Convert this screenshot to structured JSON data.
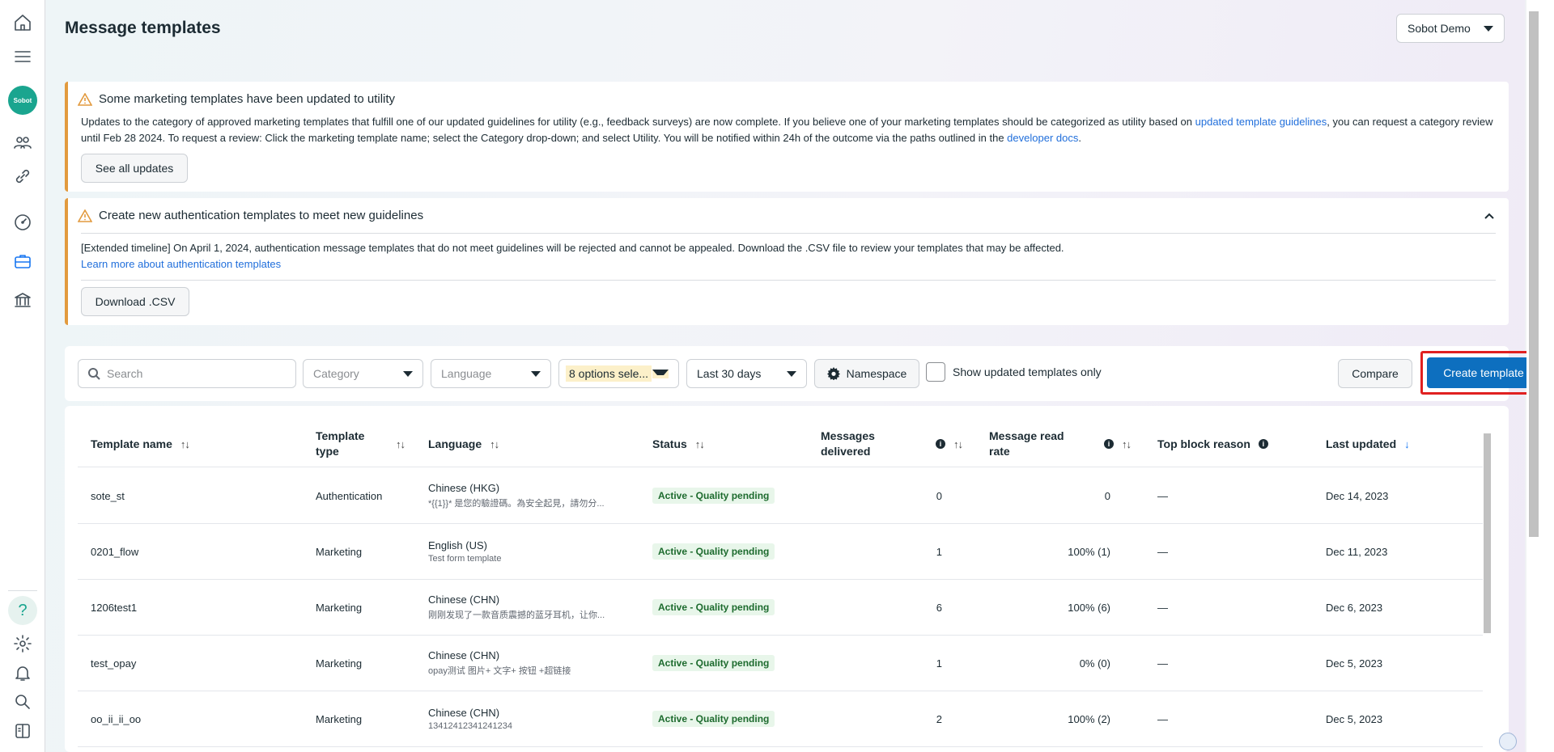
{
  "page": {
    "title": "Message templates",
    "account": "Sobot Demo"
  },
  "sidebar": {
    "logo_text": "Sobot",
    "help": "?"
  },
  "banners": [
    {
      "title": "Some marketing templates have been updated to utility",
      "body_pre": "Updates to the category of approved marketing templates that fulfill one of our updated guidelines for utility (e.g., feedback surveys) are now complete. If you believe one of your marketing templates should be categorized as utility based on ",
      "body_link1": "updated template guidelines",
      "body_mid": ", you can request a category review until Feb 28 2024. To request a review: Click the marketing template name; select the Category drop-down; and select Utility. You will be notified within 24h of the outcome via the paths outlined in the ",
      "body_link2": "developer docs",
      "body_end": ".",
      "button": "See all updates"
    },
    {
      "title": "Create new authentication templates to meet new guidelines",
      "body": "[Extended timeline] On April 1, 2024, authentication message templates that do not meet guidelines will be rejected and cannot be appealed. Download the .CSV file to review your templates that may be affected.",
      "link": "Learn more about authentication templates",
      "button": "Download .CSV"
    }
  ],
  "filters": {
    "search_placeholder": "Search",
    "category": "Category",
    "language": "Language",
    "status": "8 options sele...",
    "date_range": "Last 30 days",
    "namespace": "Namespace",
    "show_updated": "Show updated templates only",
    "compare": "Compare",
    "create": "Create template"
  },
  "table": {
    "columns": {
      "name": "Template name",
      "type": "Template type",
      "language": "Language",
      "status": "Status",
      "delivered": "Messages delivered",
      "read_rate": "Message read rate",
      "block": "Top block reason",
      "updated": "Last updated"
    },
    "rows": [
      {
        "name": "sote_st",
        "type": "Authentication",
        "language": "Chinese (HKG)",
        "preview": "*{{1}}* 是您的驗證碼。為安全起見，請勿分...",
        "status": "Active - Quality pending",
        "delivered": "0",
        "read_rate": "0",
        "block": "—",
        "updated": "Dec 14, 2023"
      },
      {
        "name": "0201_flow",
        "type": "Marketing",
        "language": "English (US)",
        "preview": "Test form template",
        "status": "Active - Quality pending",
        "delivered": "1",
        "read_rate": "100% (1)",
        "block": "—",
        "updated": "Dec 11, 2023"
      },
      {
        "name": "1206test1",
        "type": "Marketing",
        "language": "Chinese (CHN)",
        "preview": "刚刚发现了一款音质震撼的蓝牙耳机，让你...",
        "status": "Active - Quality pending",
        "delivered": "6",
        "read_rate": "100% (6)",
        "block": "—",
        "updated": "Dec 6, 2023"
      },
      {
        "name": "test_opay",
        "type": "Marketing",
        "language": "Chinese (CHN)",
        "preview": "opay测试 图片+ 文字+ 按钮 +超链接",
        "status": "Active - Quality pending",
        "delivered": "1",
        "read_rate": "0% (0)",
        "block": "—",
        "updated": "Dec 5, 2023"
      },
      {
        "name": "oo_ii_ii_oo",
        "type": "Marketing",
        "language": "Chinese (CHN)",
        "preview": "13412412341241234",
        "status": "Active - Quality pending",
        "delivered": "2",
        "read_rate": "100% (2)",
        "block": "—",
        "updated": "Dec 5, 2023"
      }
    ]
  },
  "colors": {
    "accent": "#0d6fbf",
    "warning": "#e29a3e",
    "status_bg": "#e8f6ea",
    "highlight_box": "#e02020"
  }
}
